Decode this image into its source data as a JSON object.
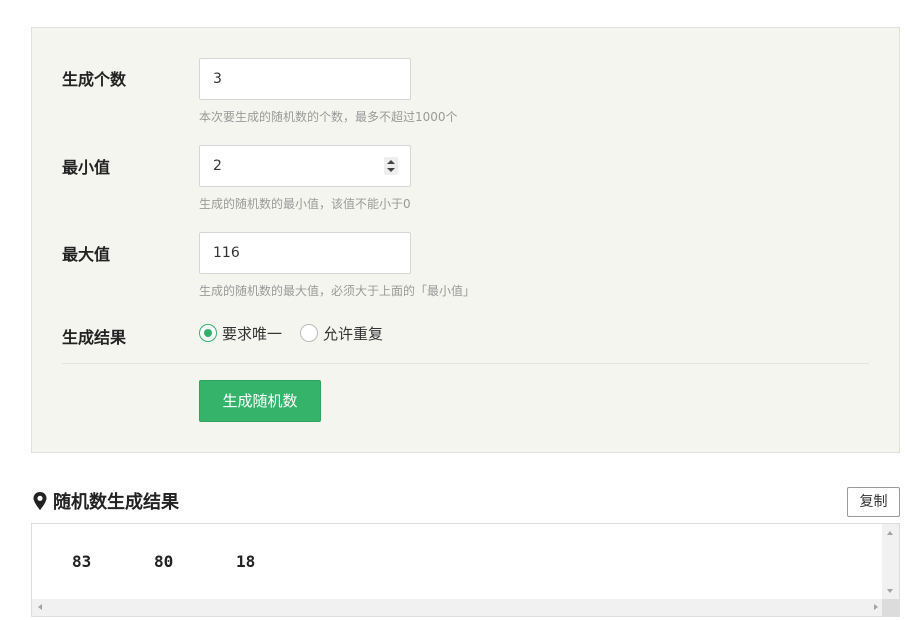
{
  "form": {
    "count": {
      "label": "生成个数",
      "value": "3",
      "hint": "本次要生成的随机数的个数，最多不超过1000个"
    },
    "min": {
      "label": "最小值",
      "value": "2",
      "hint": "生成的随机数的最小值，该值不能小于0"
    },
    "max": {
      "label": "最大值",
      "value": "116",
      "hint": "生成的随机数的最大值，必须大于上面的「最小值」"
    },
    "mode": {
      "label": "生成结果",
      "options": [
        {
          "label": "要求唯一",
          "checked": true
        },
        {
          "label": "允许重复",
          "checked": false
        }
      ]
    },
    "submit_label": "生成随机数"
  },
  "result": {
    "title": "随机数生成结果",
    "copy_label": "复制",
    "numbers": [
      "83",
      "80",
      "18"
    ]
  },
  "colors": {
    "accent": "#35b36b",
    "panel_bg": "#f5f5f0"
  }
}
